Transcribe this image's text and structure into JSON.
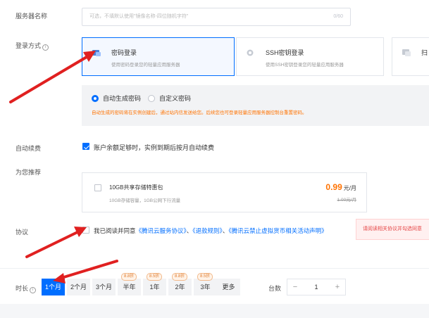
{
  "server_name": {
    "label": "服务器名称",
    "placeholder": "可选，不填默认使用\"镜像名称-四位随机字符\"",
    "counter": "0/60"
  },
  "login": {
    "label": "登录方式",
    "options": [
      {
        "title": "密码登录",
        "desc": "使用密码登录您的轻量应用服务器",
        "selected": true
      },
      {
        "title": "SSH密钥登录",
        "desc": "使用SSH密钥登录您的轻量应用服务器",
        "selected": false
      },
      {
        "title": "扫",
        "desc": "",
        "selected": false
      }
    ],
    "password_modes": [
      "自动生成密码",
      "自定义密码"
    ],
    "password_mode_selected": "自动生成密码",
    "note": "自动生成的密码将在实例创建后，通过站内信发送给您。后续您也可登录轻量应用服务器控制台重置密码。"
  },
  "auto_renew": {
    "label": "自动续费",
    "checked": true,
    "text": "账户余额足够时，实例到期后按月自动续费"
  },
  "recommend": {
    "label": "为您推荐",
    "item_title": "10GB共享存储特惠包",
    "item_desc": "10GB存储容量，1GB公网下行流量",
    "price": "0.99",
    "price_unit": "元/月",
    "old_price": "1.00元/月",
    "checked": false
  },
  "agreement": {
    "label": "协议",
    "prefix": "我已阅读并同意",
    "link1": "《腾讯云服务协议》",
    "sep1": "、",
    "link2": "《退款规则》",
    "sep2": "、",
    "link3": "《腾讯云禁止虚拟货币相关活动声明》",
    "warning": "请阅读相关协议并勾选同意",
    "checked": false
  },
  "duration": {
    "label": "时长",
    "options": [
      {
        "label": "1个月",
        "discount": "",
        "active": true
      },
      {
        "label": "2个月",
        "discount": "",
        "active": false
      },
      {
        "label": "3个月",
        "discount": "",
        "active": false
      },
      {
        "label": "半年",
        "discount": "8.8折",
        "active": false
      },
      {
        "label": "1年",
        "discount": "8.5折",
        "active": false
      },
      {
        "label": "2年",
        "discount": "8.8折",
        "active": false
      },
      {
        "label": "3年",
        "discount": "8.5折",
        "active": false
      },
      {
        "label": "更多",
        "discount": "",
        "active": false
      }
    ]
  },
  "quantity": {
    "label": "台数",
    "value": "1",
    "minus": "−",
    "plus": "+"
  },
  "colors": {
    "accent": "#006eff",
    "warning_orange": "#ff7200",
    "arrow_red": "#e02020"
  }
}
